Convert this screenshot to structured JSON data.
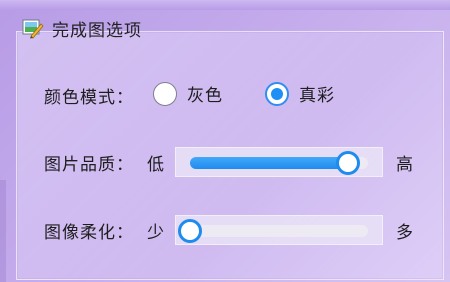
{
  "group": {
    "title": "完成图选项",
    "icon": "edit-picture-icon"
  },
  "color_mode": {
    "label": "颜色模式：",
    "options": [
      {
        "label": "灰色",
        "checked": false
      },
      {
        "label": "真彩",
        "checked": true
      }
    ]
  },
  "quality": {
    "label": "图片品质：",
    "min_label": "低",
    "max_label": "高",
    "value_fraction": 0.89
  },
  "blur": {
    "label": "图像柔化：",
    "min_label": "少",
    "max_label": "多",
    "value_fraction": 0.0
  },
  "colors": {
    "accent": "#1e8bef"
  }
}
